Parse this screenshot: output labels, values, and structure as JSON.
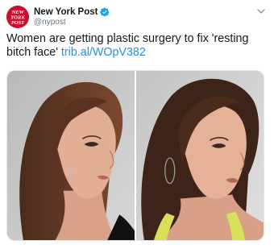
{
  "tweet": {
    "author": {
      "display_name": "New York Post",
      "handle": "@nypost",
      "verified": true,
      "avatar_logo_text": "NEW YORK POST"
    },
    "text": "Women are getting plastic surgery to fix 'resting bitch face' ",
    "link_text": "trib.al/WOpV382",
    "media": [
      {
        "name": "photo-left",
        "depiction": "woman-profile-black-top"
      },
      {
        "name": "photo-right",
        "depiction": "woman-profile-yellow-top"
      }
    ]
  },
  "colors": {
    "brand_red": "#c8102e",
    "link_blue": "#1b95e0",
    "verified_blue": "#1da1f2",
    "handle_gray": "#657786"
  },
  "icons": {
    "verified": "verified-badge-icon",
    "more": "chevron-down-icon"
  }
}
